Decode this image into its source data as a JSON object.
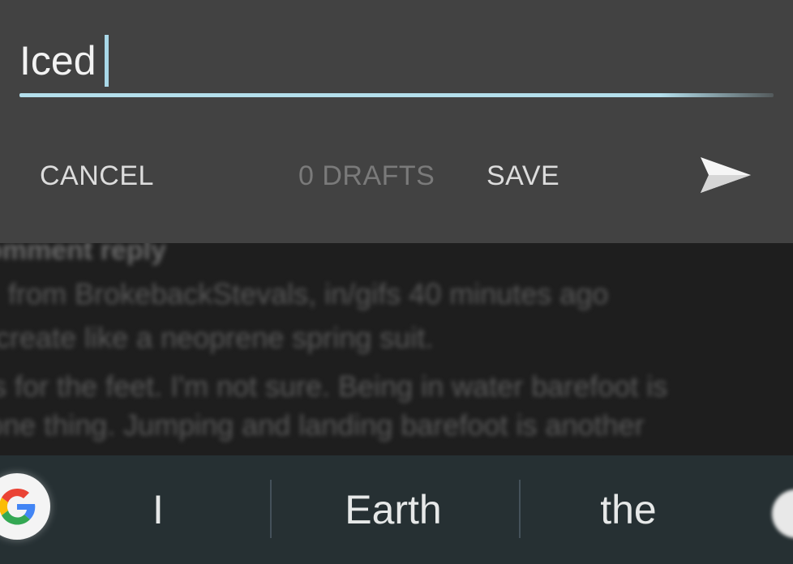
{
  "compose": {
    "input_value": "Iced",
    "cancel_label": "CANCEL",
    "drafts_label": "0 DRAFTS",
    "save_label": "SAVE",
    "send_icon": "send-icon",
    "accent_color": "#b4dfec"
  },
  "background": {
    "title": "omment reply",
    "line1": "from BrokebackStevals, in/gifs 40 minutes ago",
    "line2": "create like a neoprene spring suit.",
    "line3": "s for the feet. I'm not sure. Being in water barefoot is",
    "line4": "one thing. Jumping and landing barefoot is another"
  },
  "suggestions": {
    "logo_icon": "google-g-icon",
    "items": [
      "I",
      "Earth",
      "the"
    ]
  }
}
